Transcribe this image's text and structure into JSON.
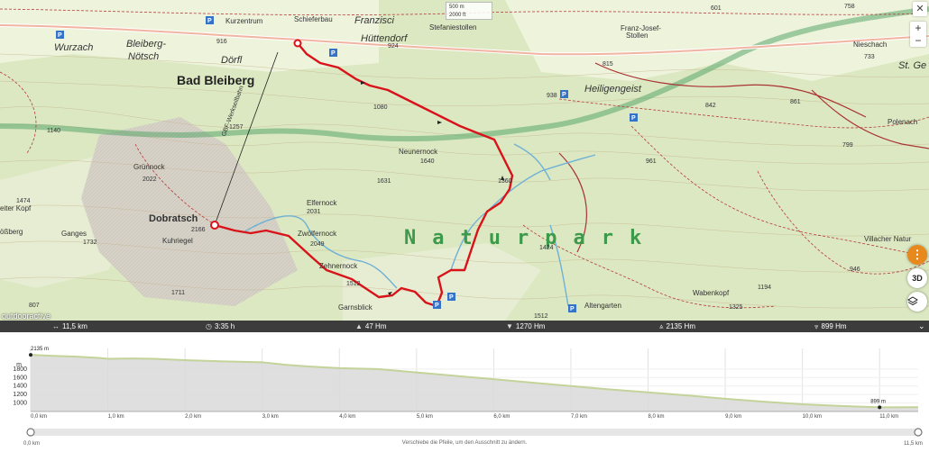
{
  "map": {
    "scale_labels": [
      "500 m",
      "2000 ft"
    ],
    "places": {
      "bad_bleiberg": "Bad Bleiberg",
      "bleiberg_notsch": [
        "Bleiberg-",
        "Nötsch"
      ],
      "wurzach": "Wurzach",
      "dorfl": "Dörfl",
      "huttendorf": "Hüttendorf",
      "franzisci": "Franzisci",
      "heiligengeist": "Heiligengeist",
      "dobratsch": "Dobratsch",
      "kuhriegel": "Kuhriegel",
      "ganges": "Ganges",
      "weiter_kopf": "eiter Kopf",
      "grunnock": "Grünnock",
      "elfernock": "Elfernock",
      "zwolfernock": "Zwölfernock",
      "zehnernock": "Zehnernock",
      "neunernock": "Neunernock",
      "garnsblick": "Garnsblick",
      "wabenkopf": "Wabenkopf",
      "altengarten": "Altengarten",
      "niesschach": "Nieschach",
      "st_ge": "St. Ge",
      "polenach": "Polenach",
      "villacher_natur": "Villacher Natur",
      "schieferbau": "Schieferbau",
      "kurzentrum": "Kurzentrum",
      "stefanie": "Stefaniestollen",
      "franz_josef": [
        "Franz-Josef-",
        "Stollen"
      ],
      "naturpark": "Naturpark",
      "bblift": "GBF-Werkseilbahn",
      "flosberg": "ößberg"
    },
    "elevations": {
      "e_916": "916",
      "e_924": "924",
      "e_815": "815",
      "e_938": "938",
      "e_1080": "1080",
      "e_1257": "1257",
      "e_1140": "1140",
      "e_1640": "1640",
      "e_2022": "2022",
      "e_1631": "1631",
      "e_1360": "1360",
      "e_2031": "2031",
      "e_2049": "2049",
      "e_2166": "2166",
      "e_1474": "1474",
      "e_1732": "1732",
      "e_1711": "1711",
      "e_807": "807",
      "e_1424": "1424",
      "e_961": "961",
      "e_799": "799",
      "e_861": "861",
      "e_733": "733",
      "e_601": "601",
      "e_758": "758",
      "e_946": "946",
      "e_1194": "1194",
      "e_1325": "1325",
      "e_1512": "1512",
      "e_1512b": "1512",
      "e_842": "842"
    },
    "controls": {
      "close": "✕",
      "zoom_in": "+",
      "zoom_out": "−",
      "menu": "⋮",
      "three_d": "3D"
    },
    "attribution": "outdooractive",
    "colors": {
      "route": "#d8131a",
      "water": "#6fb1d6",
      "forest": "#dbe8c1",
      "meadow": "#eef3dc",
      "rock": "#d6d2c8"
    }
  },
  "stats": {
    "distance": "11,5 km",
    "duration": "3:35 h",
    "ascent": "47 Hm",
    "descent": "1270 Hm",
    "max_alt": "2135 Hm",
    "min_alt": "899 Hm"
  },
  "chart_data": {
    "type": "area",
    "title": "",
    "xlabel": "",
    "ylabel": "m",
    "xlim": [
      0,
      11.5
    ],
    "ylim": [
      899,
      2135
    ],
    "x_ticks": [
      "0,0 km",
      "1,0 km",
      "2,0 km",
      "3,0 km",
      "4,0 km",
      "5,0 km",
      "6,0 km",
      "7,0 km",
      "8,0 km",
      "9,0 km",
      "10,0 km",
      "11,0 km"
    ],
    "y_ticks": [
      "1000",
      "1200",
      "1400",
      "1600",
      "1800"
    ],
    "y_unit": "m",
    "max_label": "2135 m",
    "min_label": "899 m",
    "series": [
      {
        "x": [
          0,
          0.3,
          0.6,
          0.9,
          1.0,
          1.3,
          1.6,
          2.0,
          2.5,
          3.0,
          3.3,
          3.6,
          4.0,
          4.5,
          5.0,
          5.5,
          6.0,
          6.5,
          7.0,
          7.5,
          8.0,
          8.5,
          9.0,
          9.5,
          10.0,
          10.5,
          11.0,
          11.5
        ],
        "y": [
          2135,
          2110,
          2090,
          2060,
          2040,
          2050,
          2040,
          2010,
          1980,
          1960,
          1900,
          1860,
          1820,
          1800,
          1720,
          1640,
          1560,
          1480,
          1400,
          1320,
          1250,
          1180,
          1100,
          1030,
          970,
          930,
          899,
          900
        ]
      }
    ],
    "slider": {
      "start": "0,0 km",
      "end": "11,5 km"
    },
    "hint": "Verschiebe die Pfeile, um den Ausschnitt zu ändern."
  }
}
